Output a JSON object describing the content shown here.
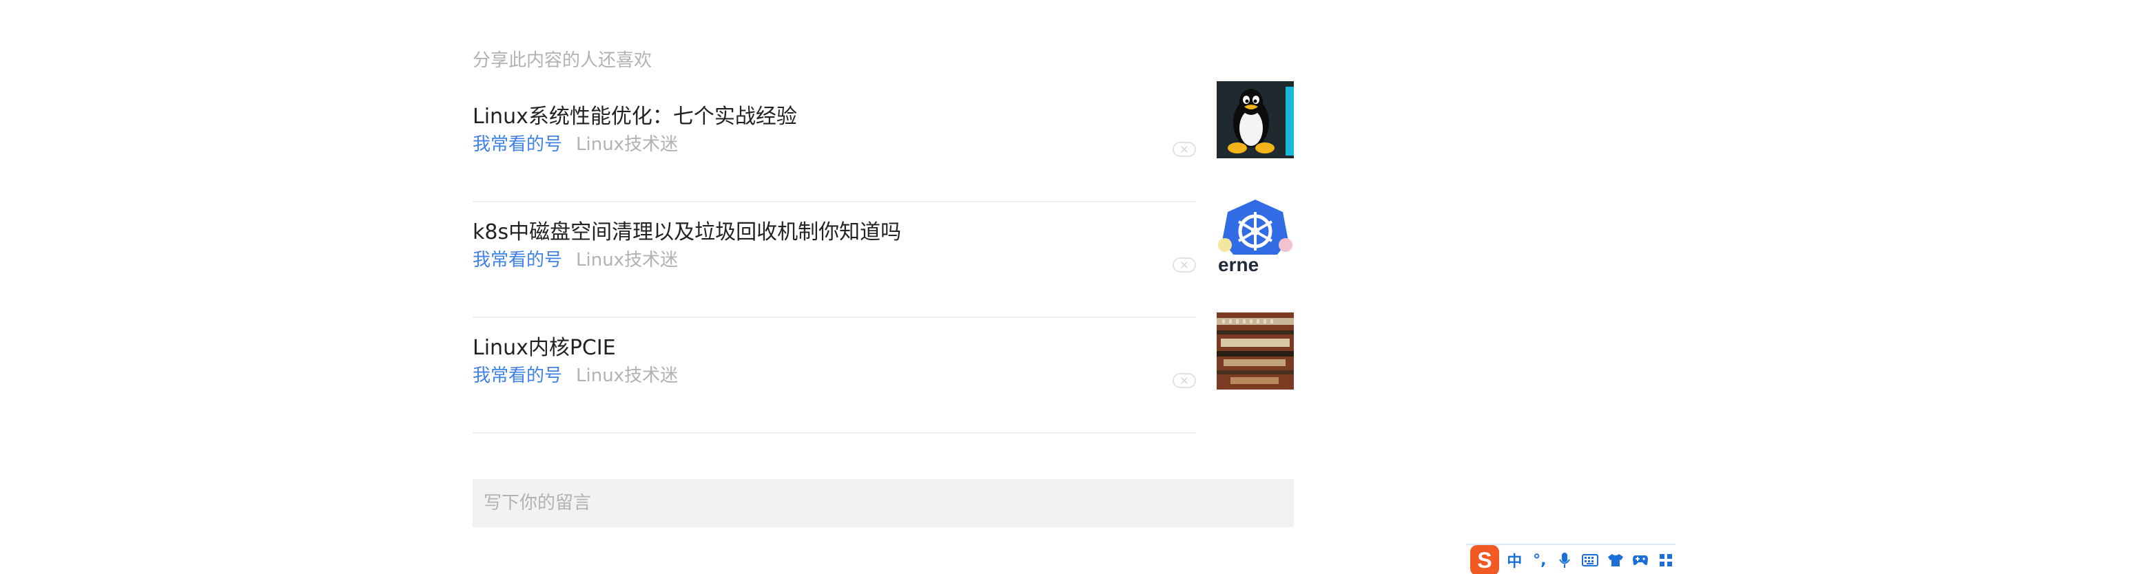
{
  "section": {
    "title": "分享此内容的人还喜欢"
  },
  "recommendations": [
    {
      "title": "Linux系统性能优化：七个实战经验",
      "tag": "我常看的号",
      "source": "Linux技术迷",
      "thumbnail_icon": "tux-penguin-icon"
    },
    {
      "title": "k8s中磁盘空间清理以及垃圾回收机制你知道吗",
      "tag": "我常看的号",
      "source": "Linux技术迷",
      "thumbnail_icon": "kubernetes-wheel-icon"
    },
    {
      "title": "Linux内核PCIE",
      "tag": "我常看的号",
      "source": "Linux技术迷",
      "thumbnail_icon": "circuit-board-image"
    }
  ],
  "comment": {
    "placeholder": "写下你的留言"
  },
  "ime_toolbar": {
    "logo": "S",
    "mode": "中",
    "punctuation": "°,",
    "icons": [
      "microphone-icon",
      "keyboard-icon",
      "shirt-icon",
      "gamepad-icon",
      "apps-grid-icon"
    ]
  },
  "colors": {
    "accent": "#3f82e8",
    "muted": "#b2b2b2",
    "title": "#222222",
    "ime_logo": "#f25a24",
    "ime_icon": "#1b6fd8"
  }
}
